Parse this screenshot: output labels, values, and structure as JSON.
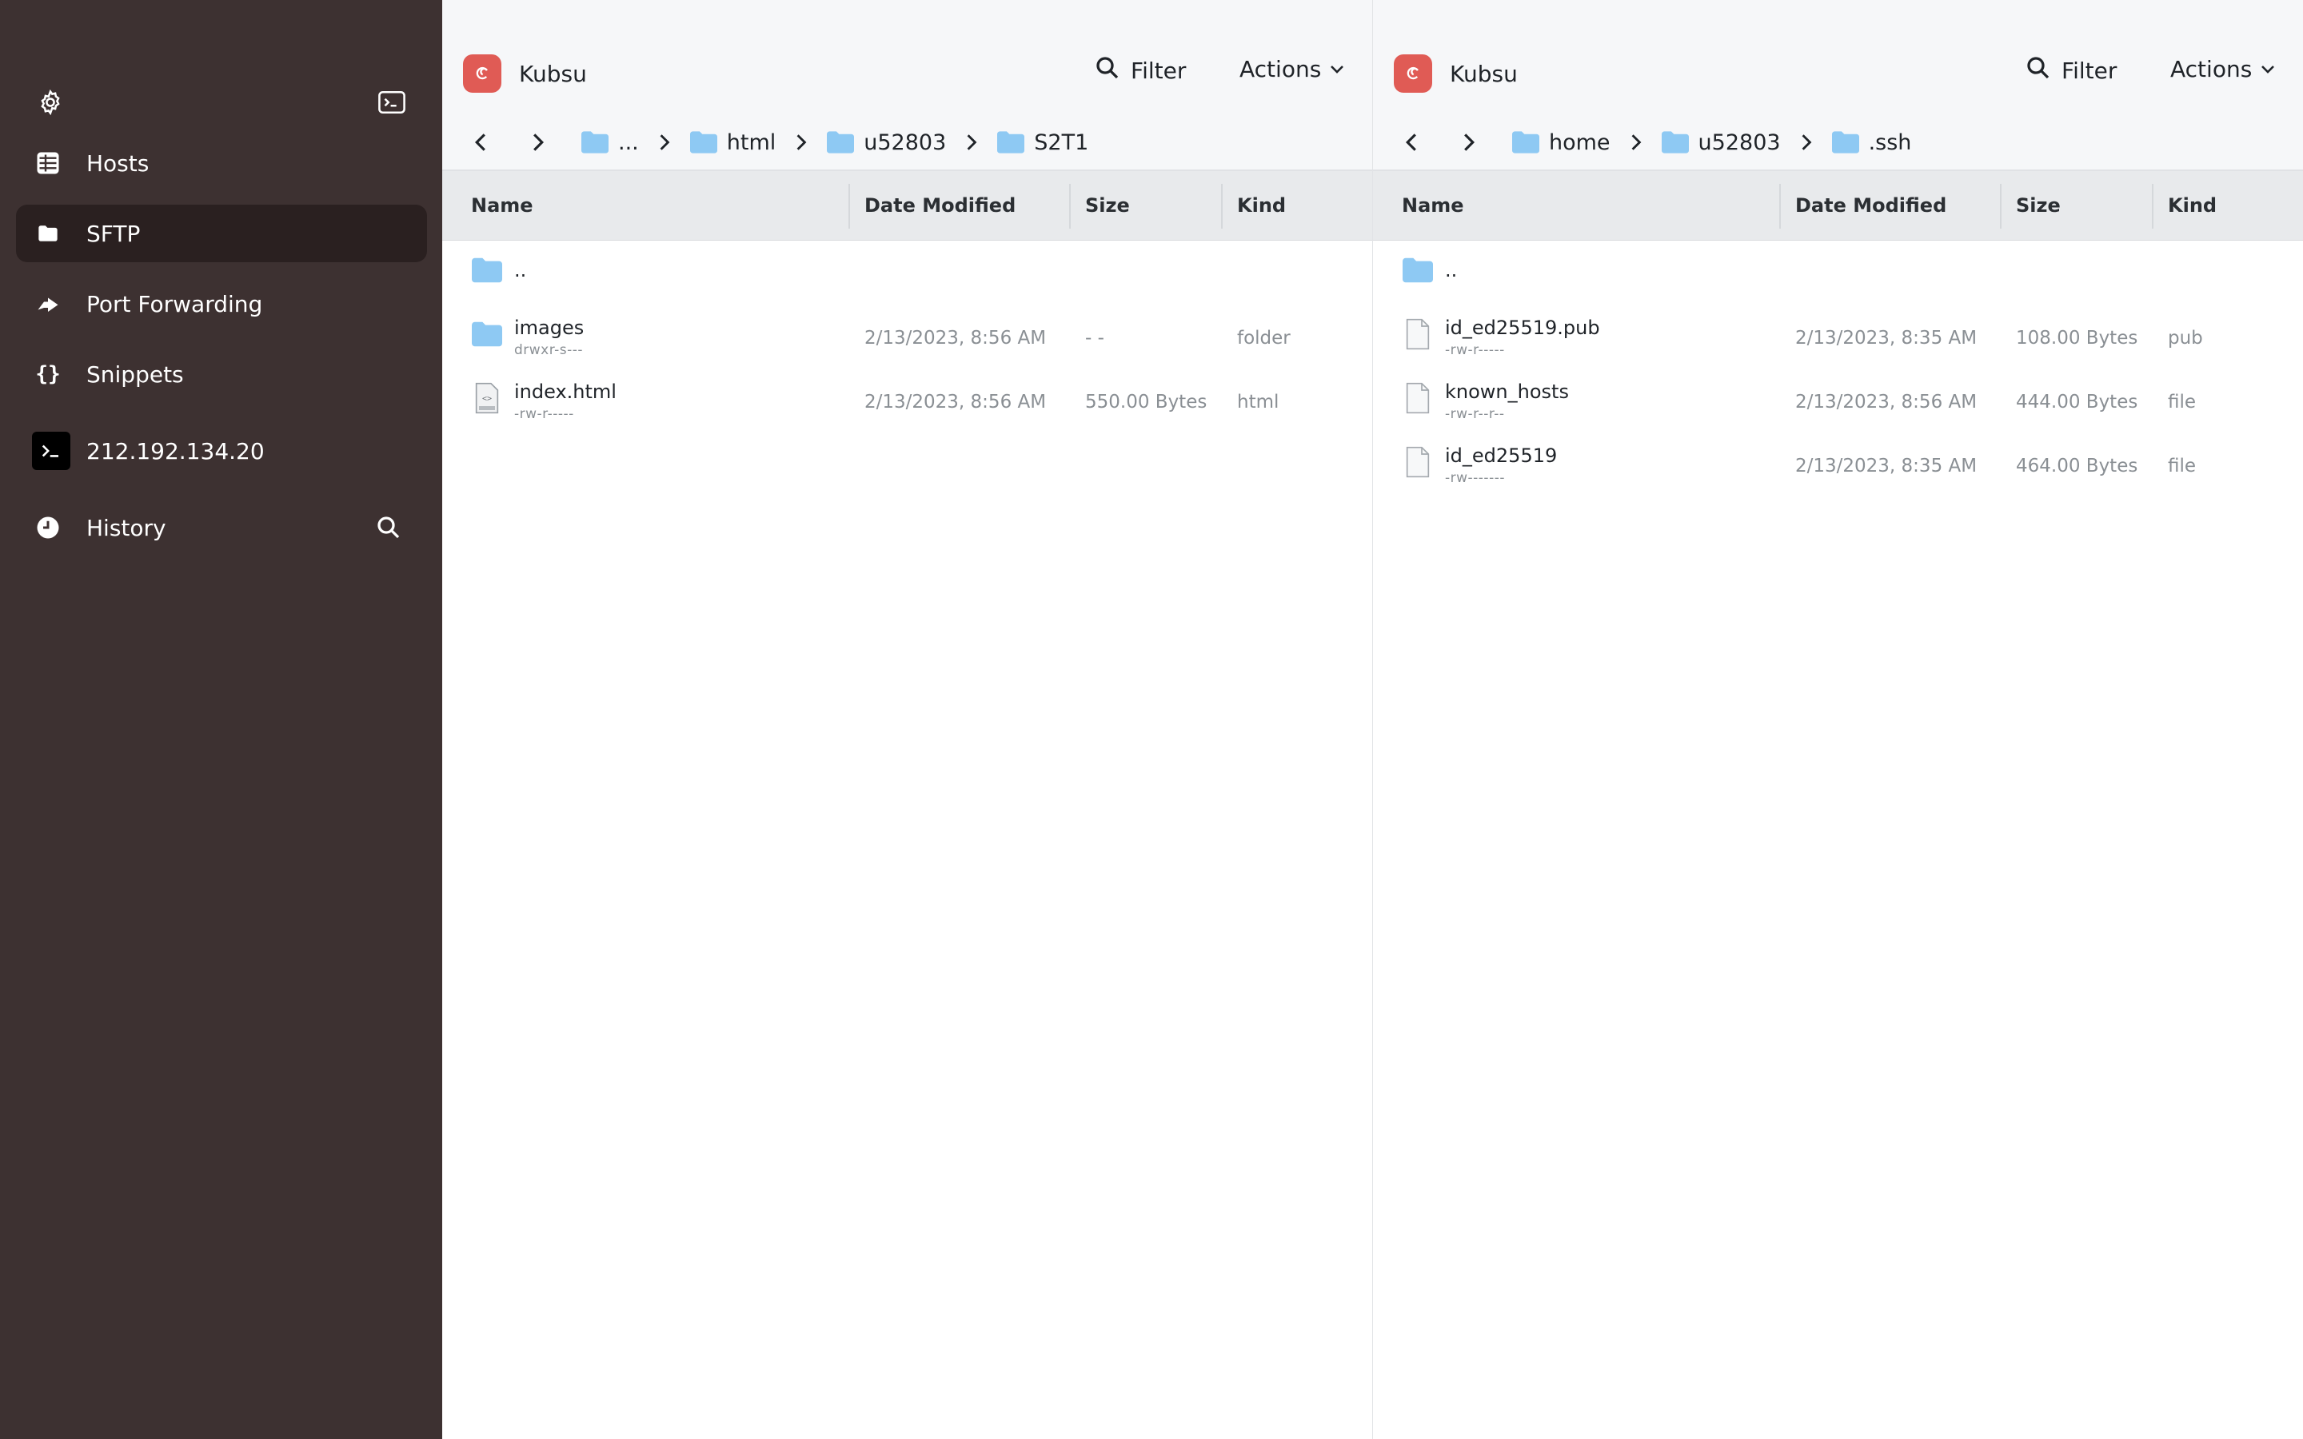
{
  "sidebar": {
    "items": [
      {
        "label": "Hosts",
        "icon": "hosts-icon"
      },
      {
        "label": "SFTP",
        "icon": "folder-icon",
        "active": true
      },
      {
        "label": "Port Forwarding",
        "icon": "port-forwarding-icon"
      },
      {
        "label": "Snippets",
        "icon": "braces-icon"
      },
      {
        "label": "212.192.134.20",
        "icon": "terminal-icon"
      },
      {
        "label": "History",
        "icon": "clock-icon"
      }
    ]
  },
  "left_pane": {
    "host": "Kubsu",
    "filter_label": "Filter",
    "actions_label": "Actions",
    "breadcrumbs": [
      "...",
      "html",
      "u52803",
      "S2T1"
    ],
    "columns": [
      "Name",
      "Date Modified",
      "Size",
      "Kind"
    ],
    "rows": [
      {
        "name": "..",
        "perm": "",
        "date": "",
        "size": "",
        "kind": "",
        "type": "folder"
      },
      {
        "name": "images",
        "perm": "drwxr-s---",
        "date": "2/13/2023, 8:56 AM",
        "size": "- -",
        "kind": "folder",
        "type": "folder"
      },
      {
        "name": "index.html",
        "perm": "-rw-r-----",
        "date": "2/13/2023, 8:56 AM",
        "size": "550.00 Bytes",
        "kind": "html",
        "type": "html"
      }
    ]
  },
  "right_pane": {
    "host": "Kubsu",
    "filter_label": "Filter",
    "actions_label": "Actions",
    "breadcrumbs": [
      "home",
      "u52803",
      ".ssh"
    ],
    "columns": [
      "Name",
      "Date Modified",
      "Size",
      "Kind"
    ],
    "rows": [
      {
        "name": "..",
        "perm": "",
        "date": "",
        "size": "",
        "kind": "",
        "type": "folder"
      },
      {
        "name": "id_ed25519.pub",
        "perm": "-rw-r-----",
        "date": "2/13/2023, 8:35 AM",
        "size": "108.00 Bytes",
        "kind": "pub",
        "type": "file"
      },
      {
        "name": "known_hosts",
        "perm": "-rw-r--r--",
        "date": "2/13/2023, 8:56 AM",
        "size": "444.00 Bytes",
        "kind": "file",
        "type": "file"
      },
      {
        "name": "id_ed25519",
        "perm": "-rw-------",
        "date": "2/13/2023, 8:35 AM",
        "size": "464.00 Bytes",
        "kind": "file",
        "type": "file"
      }
    ]
  },
  "colors": {
    "sidebar_bg": "#3d3131",
    "sidebar_active": "#2a2020",
    "host_logo": "#e05b55",
    "folder": "#8ec9f3"
  }
}
